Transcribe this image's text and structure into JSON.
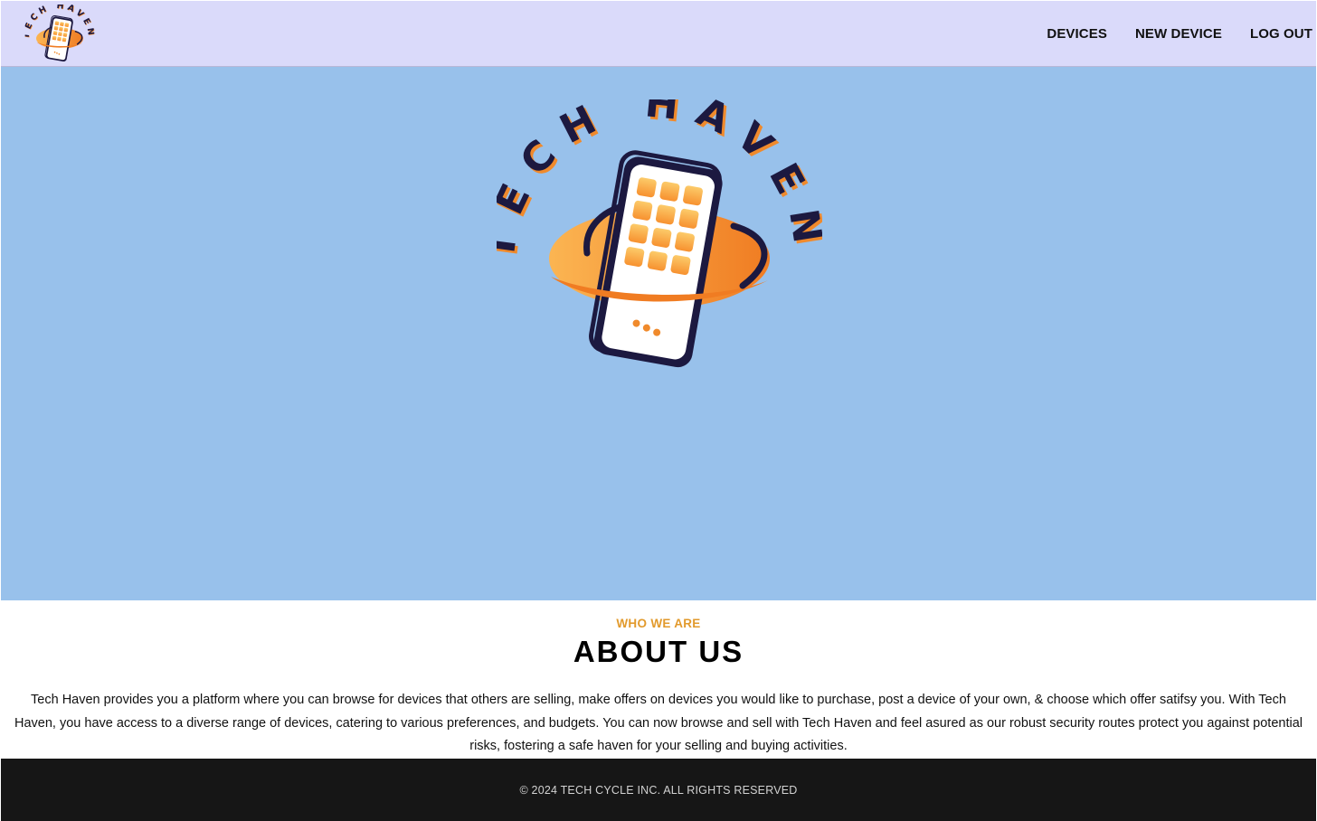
{
  "brand": {
    "name": "TECH HAVEN",
    "colors": {
      "ink": "#1c1940",
      "orange": "#f4942e",
      "orange_light": "#fbb552",
      "shadow": "#f08a2c"
    }
  },
  "navbar": {
    "logo_icon": "tech-haven-logo",
    "links": [
      {
        "label": "DEVICES"
      },
      {
        "label": "NEW DEVICE"
      },
      {
        "label": "LOG OUT"
      }
    ]
  },
  "hero": {
    "logo_icon": "tech-haven-logo",
    "background": "#98c1eb"
  },
  "about": {
    "eyebrow": "WHO WE ARE",
    "title": "ABOUT US",
    "text": "Tech Haven provides you a platform where you can browse for devices that others are selling, make offers on devices you would like to purchase, post a device of your own, & choose which offer satifsy you. With Tech Haven, you have access to a diverse range of devices, catering to various preferences, and budgets. You can now browse and sell with Tech Haven and feel asured as our robust security routes protect you against potential risks, fostering a safe haven for your selling and buying activities."
  },
  "footer": {
    "text": "© 2024 TECH CYCLE INC. ALL RIGHTS RESERVED"
  }
}
